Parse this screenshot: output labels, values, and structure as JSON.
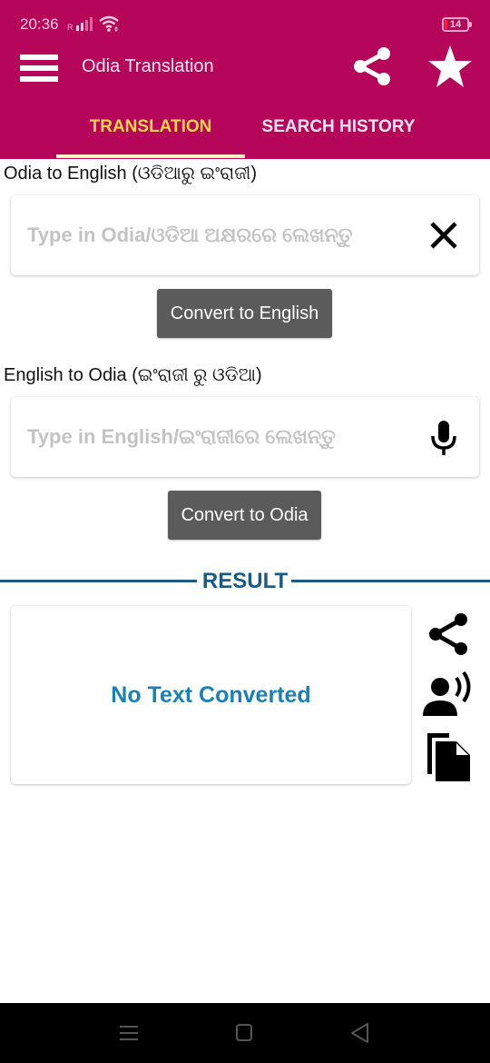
{
  "status_bar": {
    "time": "20:36",
    "signal_label": "R",
    "battery": "14",
    "battery_low_color": "#ff2040"
  },
  "app_bar": {
    "title": "Odia Translation",
    "background_color": "#b5065a",
    "icons": [
      "menu-icon",
      "share-icon",
      "star-icon"
    ]
  },
  "tabs": [
    {
      "label": "TRANSLATION",
      "active": true,
      "color": "#f9d54a"
    },
    {
      "label": "SEARCH HISTORY",
      "active": false
    }
  ],
  "odia_to_english": {
    "label": "Odia to English (ଓଡିଆରୁ ଇଂରାଜୀ)",
    "placeholder": "Type in Odia/ଓଡିଆ ଅକ୍ଷରରେ ଲେଖନ୍ତୁ",
    "value": "",
    "action_icon": "close-icon",
    "button_label": "Convert to English"
  },
  "english_to_odia": {
    "label": "English to Odia (ଇଂରାଜୀ ରୁ ଓଡିଆ)",
    "placeholder": "Type in English/ଇଂରାଜୀରେ ଲେଖନ୍ତୁ",
    "value": "",
    "action_icon": "microphone-icon",
    "button_label": "Convert to Odia"
  },
  "result": {
    "title": "RESULT",
    "text": "No Text Converted",
    "accent_color": "#1a5b86",
    "text_color": "#1a80b6",
    "actions": [
      "share-icon",
      "speak-icon",
      "copy-icon"
    ]
  },
  "nav_bar": {
    "buttons": [
      "recents-icon",
      "home-icon",
      "back-icon"
    ]
  }
}
